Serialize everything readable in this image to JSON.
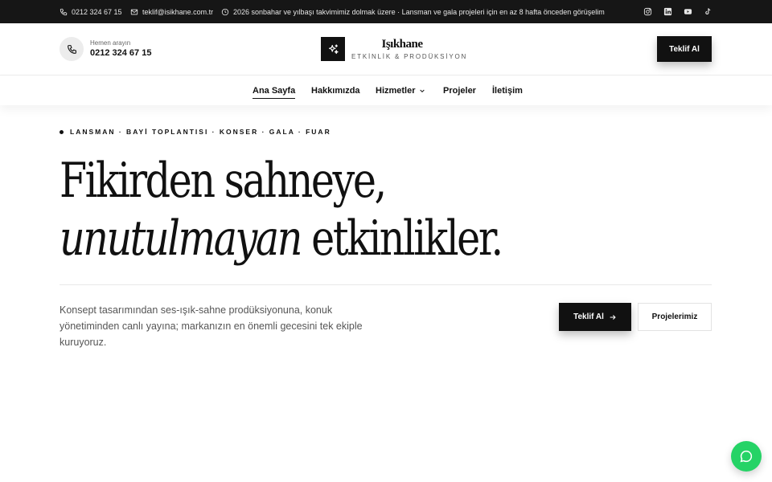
{
  "topbar": {
    "phone": "0212 324 67 15",
    "email": "teklif@isikhane.com.tr",
    "announcement": "2026 sonbahar ve yılbaşı takvimimiz dolmak üzere · Lansman ve gala projeleri için en az 8 hafta önceden görüşelim",
    "social": [
      "instagram-icon",
      "linkedin-icon",
      "youtube-icon",
      "tiktok-icon"
    ]
  },
  "header": {
    "call_label": "Hemen arayın",
    "call_number": "0212 324 67 15",
    "brand": "Işıkhane",
    "brand_sub": "ETKİNLİK & PRODÜKSİYON",
    "cta": "Teklif Al"
  },
  "nav": {
    "items": [
      "Ana Sayfa",
      "Hakkımızda",
      "Hizmetler",
      "Projeler",
      "İletişim"
    ],
    "active": "Ana Sayfa"
  },
  "hero": {
    "eyebrow": "LANSMAN · BAYİ TOPLANTISI · KONSER · GALA · FUAR",
    "title_line1": "Fikirden sahneye,",
    "title_line2_italic": "unutulmayan",
    "title_line2_rest": " etkinlikler.",
    "lead": "Konsept tasarımından ses-ışık-sahne prodüksiyonuna, konuk yönetiminden canlı yayına; markanızın en önemli gecesini tek ekiple kuruyoruz.",
    "primary_cta": "Teklif Al",
    "secondary_cta": "Projelerimiz"
  },
  "colors": {
    "topbar_bg": "#161616",
    "dark_button": "#111111",
    "chat_green": "#25d366"
  }
}
